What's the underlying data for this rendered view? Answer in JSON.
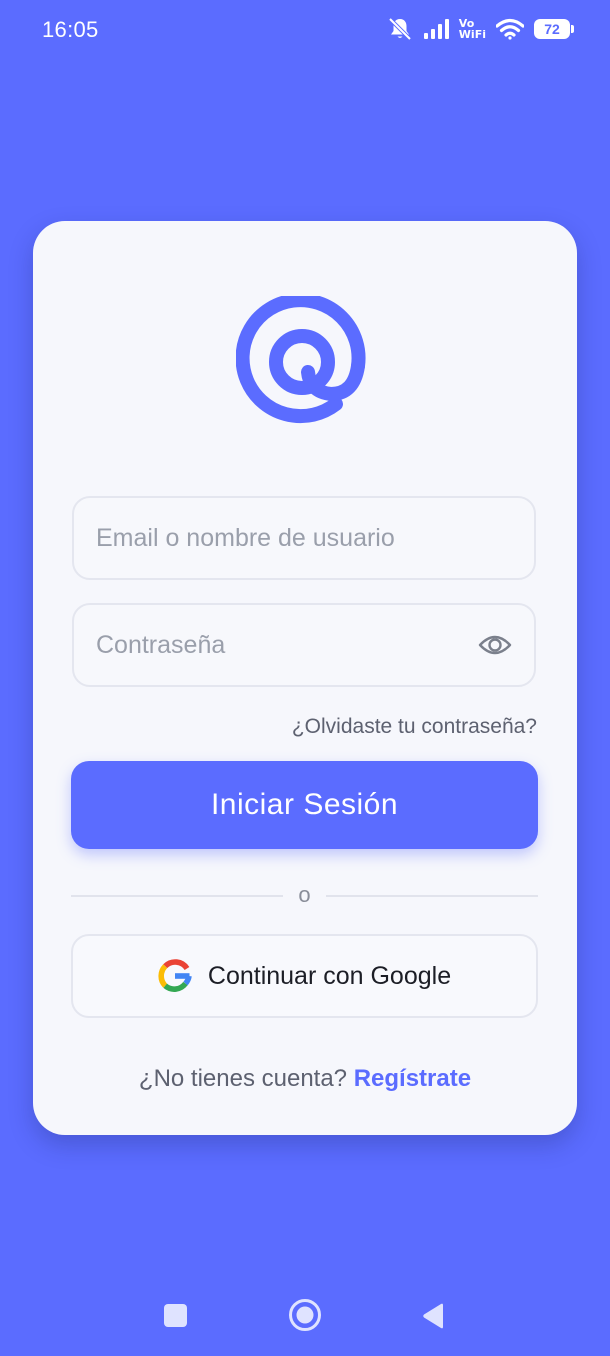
{
  "status_bar": {
    "time": "16:05",
    "vowifi_top": "Vo",
    "vowifi_bottom": "WiFi",
    "battery": "72",
    "icons": [
      "bell-muted-icon",
      "signal-icon",
      "vowifi-icon",
      "wifi-icon",
      "battery-icon"
    ]
  },
  "login": {
    "logo_icon": "at-sign-logo-icon",
    "email_placeholder": "Email o nombre de usuario",
    "email_value": "",
    "password_placeholder": "Contraseña",
    "password_value": "",
    "password_toggle_icon": "eye-icon",
    "forgot_password": "¿Olvidaste tu contraseña?",
    "submit_label": "Iniciar Sesión",
    "divider_text": "o",
    "google_label": "Continuar con Google",
    "google_icon": "google-icon",
    "no_account": "¿No tienes cuenta? ",
    "register_link": "Regístrate"
  },
  "nav_bar": {
    "icons": [
      "recents-square-icon",
      "home-circle-icon",
      "back-triangle-icon"
    ]
  },
  "colors": {
    "background": "#5b6cff",
    "card": "#f6f7fc",
    "accent": "#5b6cff",
    "border": "#e4e6ef",
    "placeholder": "#9a9fab",
    "muted_text": "#5d6170"
  }
}
